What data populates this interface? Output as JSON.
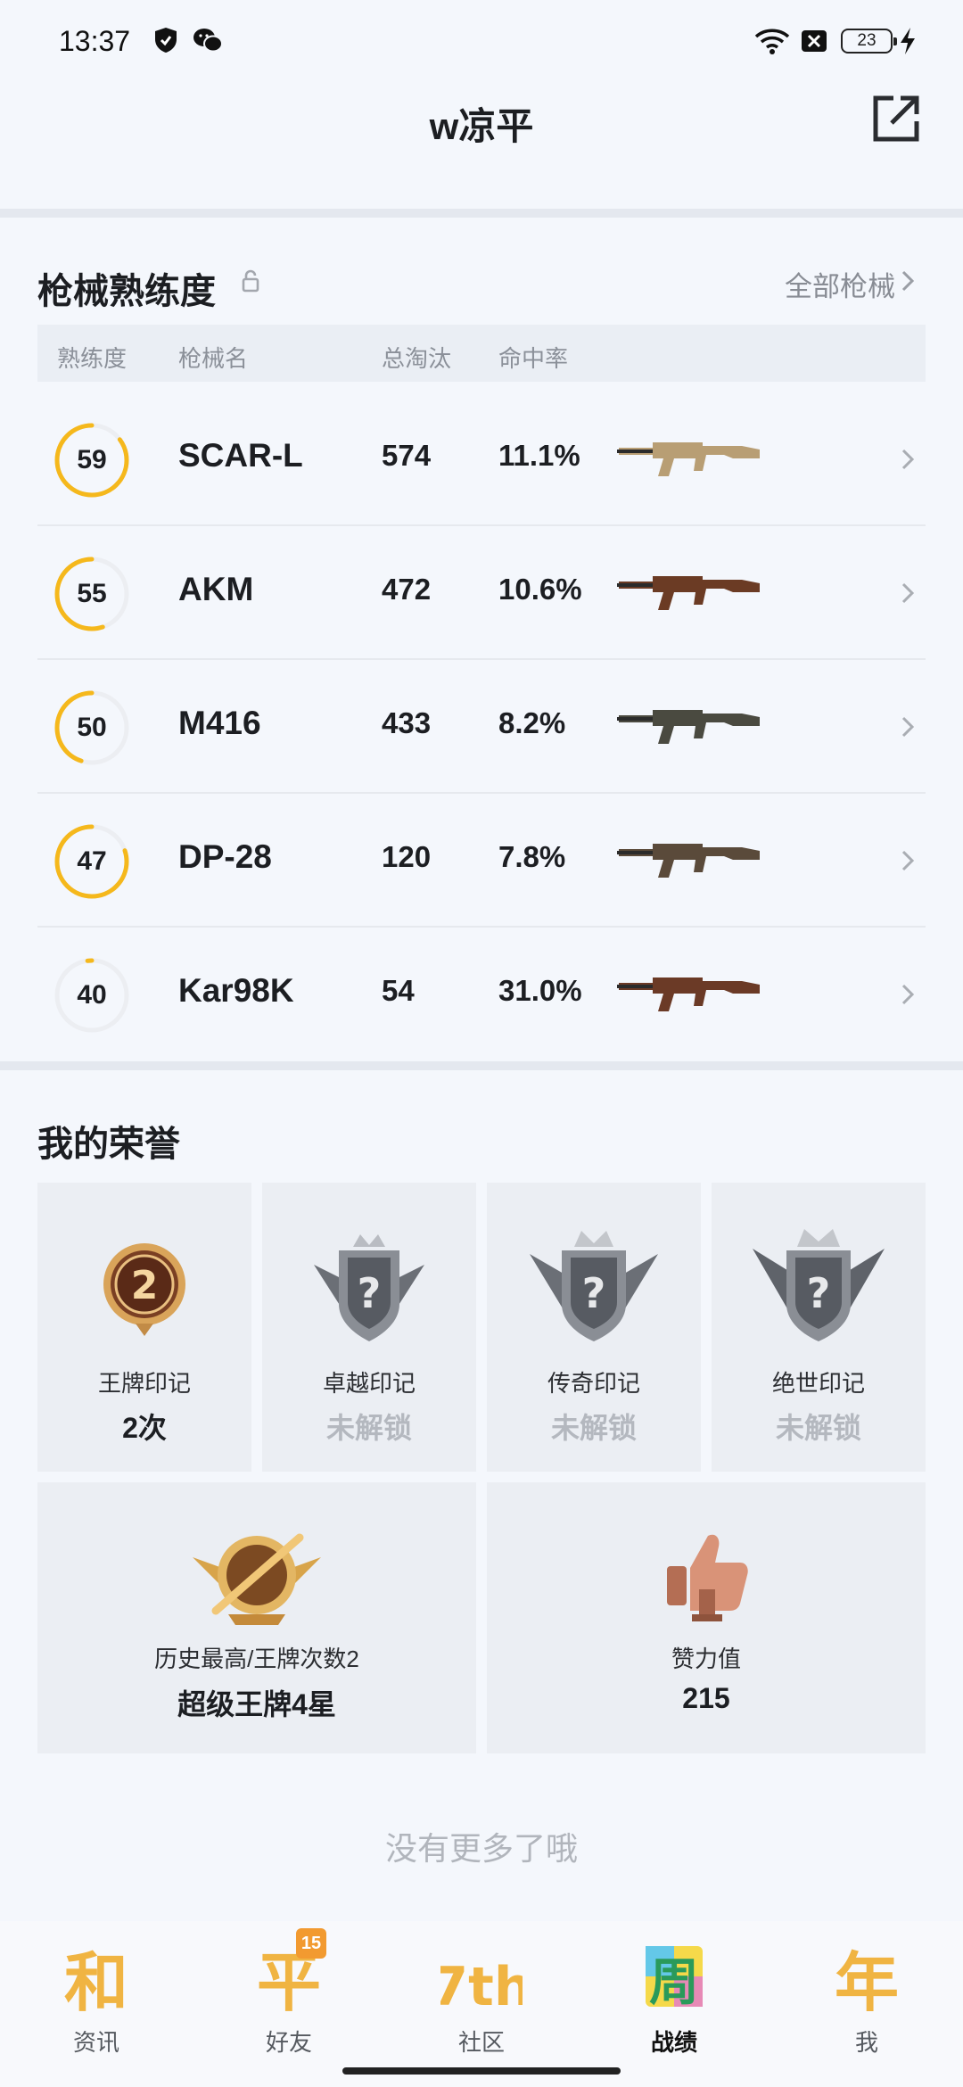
{
  "status_bar": {
    "time": "13:37",
    "battery": "23"
  },
  "header": {
    "title": "w凉平"
  },
  "weapons": {
    "title": "枪械熟练度",
    "see_all": "全部枪械",
    "columns": [
      "熟练度",
      "枪械名",
      "总淘汰",
      "命中率"
    ],
    "rows": [
      {
        "level": "59",
        "name": "SCAR-L",
        "kills": "574",
        "accuracy": "11.1%",
        "progress": 0.85,
        "gun_color": "#b89e74"
      },
      {
        "level": "55",
        "name": "AKM",
        "kills": "472",
        "accuracy": "10.6%",
        "progress": 0.55,
        "gun_color": "#6b3b24"
      },
      {
        "level": "50",
        "name": "M416",
        "kills": "433",
        "accuracy": "8.2%",
        "progress": 0.45,
        "gun_color": "#4a4a40"
      },
      {
        "level": "47",
        "name": "DP-28",
        "kills": "120",
        "accuracy": "7.8%",
        "progress": 0.8,
        "gun_color": "#5a4a3a"
      },
      {
        "level": "40",
        "name": "Kar98K",
        "kills": "54",
        "accuracy": "31.0%",
        "progress": 0.02,
        "gun_color": "#6b3a26"
      }
    ]
  },
  "honors": {
    "title": "我的荣誉",
    "marks": [
      {
        "label": "王牌印记",
        "value": "2次",
        "locked": false,
        "badge_number": "2"
      },
      {
        "label": "卓越印记",
        "value": "未解锁",
        "locked": true
      },
      {
        "label": "传奇印记",
        "value": "未解锁",
        "locked": true
      },
      {
        "label": "绝世印记",
        "value": "未解锁",
        "locked": true
      }
    ],
    "summary": [
      {
        "label": "历史最高/王牌次数2",
        "value": "超级王牌4星"
      },
      {
        "label": "赞力值",
        "value": "215"
      }
    ]
  },
  "footer_note": "没有更多了哦",
  "tabs": [
    {
      "label": "资讯",
      "icon": "和",
      "active": false
    },
    {
      "label": "好友",
      "icon": "平",
      "badge": "15",
      "active": false
    },
    {
      "label": "社区",
      "icon": "7th",
      "active": false
    },
    {
      "label": "战绩",
      "icon": "周",
      "active": true
    },
    {
      "label": "我",
      "icon": "年",
      "active": false
    }
  ],
  "colors": {
    "accent": "#f5b81c",
    "ring_bg": "#eceef2"
  }
}
